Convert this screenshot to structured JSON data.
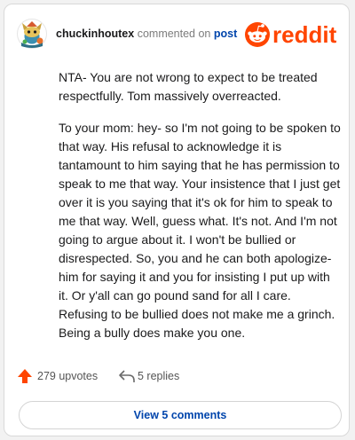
{
  "header": {
    "username": "chuckinhoutex",
    "action": "commented on",
    "link_text": "post",
    "brand": "reddit"
  },
  "comment": {
    "paragraphs": [
      "NTA- You are not wrong to expect to be treated respectfully. Tom massively overreacted.",
      "To your mom: hey- so I'm not going to be spoken to that way. His refusal to acknowledge it is tantamount to him saying that he has permission to speak to me that way. Your insistence that I just get over it is you saying that it's ok for him to speak to me that way. Well, guess what. It's not. And I'm not going to argue about it. I won't be bullied or disrespected. So, you and he can both apologize- him for saying it and you for insisting I put up with it. Or y'all can go pound sand for all I care. Refusing to be bullied does not make me a grinch. Being a bully does make you one."
    ]
  },
  "footer": {
    "upvotes": "279 upvotes",
    "replies": "5 replies",
    "view_comments": "View 5 comments"
  },
  "colors": {
    "brand_orange": "#ff4500",
    "link_blue": "#0045ac",
    "text": "#1a1a1b",
    "muted": "#7c7c7c"
  },
  "icons": {
    "avatar": "avatar-icon",
    "logo": "reddit-logo",
    "upvote": "upvote-arrow-icon",
    "reply": "reply-arrow-icon"
  }
}
